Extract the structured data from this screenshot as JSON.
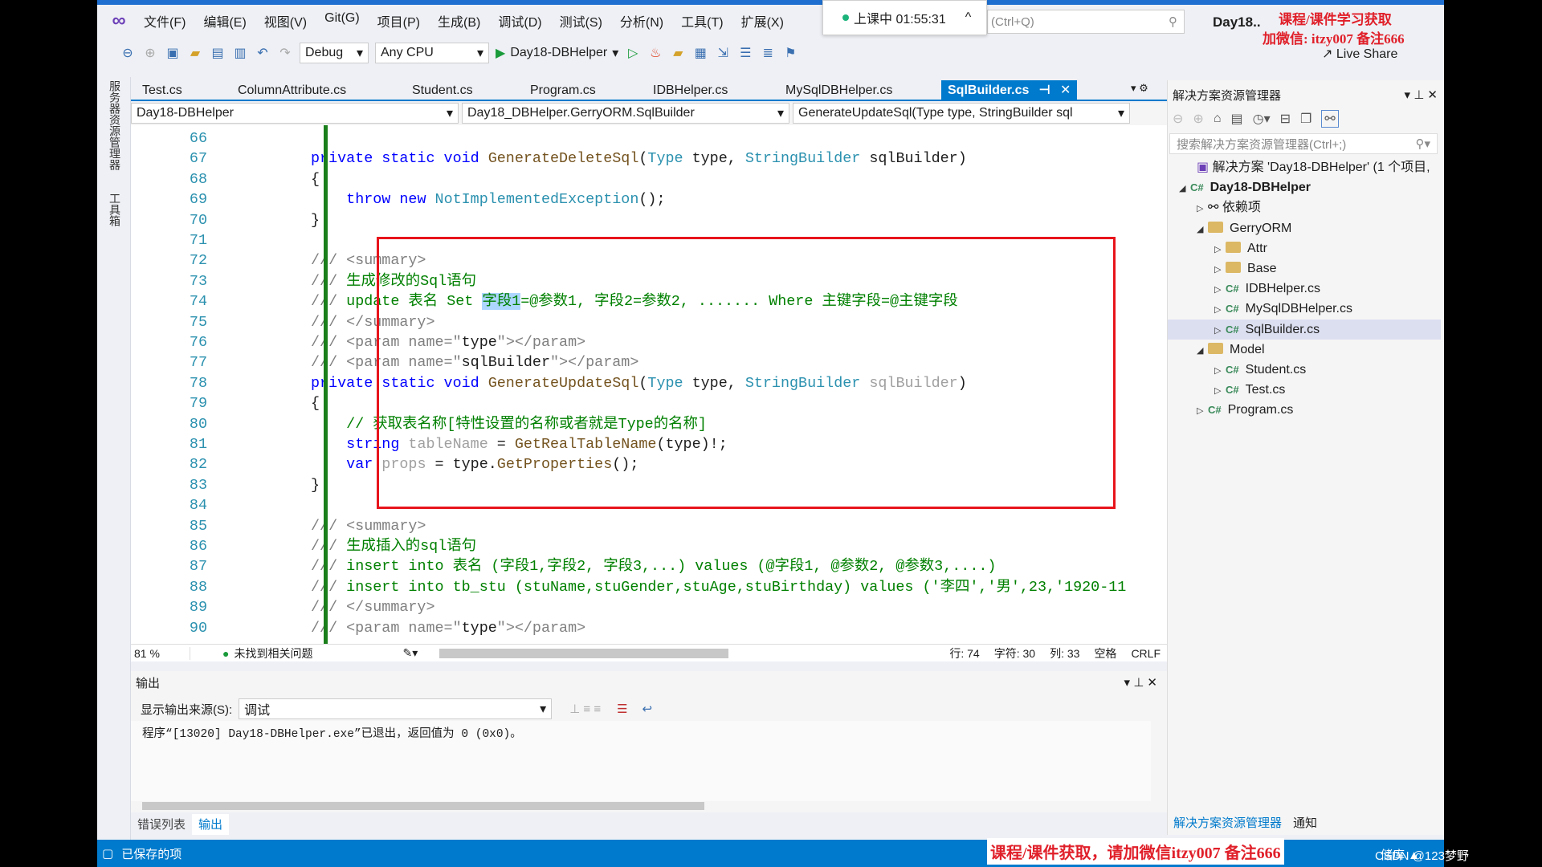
{
  "menu": {
    "items": [
      "文件(F)",
      "编辑(E)",
      "视图(V)",
      "Git(G)",
      "项目(P)",
      "生成(B)",
      "调试(D)",
      "测试(S)",
      "分析(N)",
      "工具(T)",
      "扩展(X)"
    ]
  },
  "recording": {
    "label": "上课中 01:55:31",
    "indicator_color": "#1bb37a"
  },
  "search": {
    "placeholder": "(Ctrl+Q)"
  },
  "solution_title": "Day18..",
  "watermark": {
    "line1": "课程/课件学习获取",
    "line2": "加微信: itzy007 备注666",
    "bottom": "课程/课件获取，请加微信itzy007 备注666"
  },
  "toolbar": {
    "config": "Debug",
    "platform": "Any CPU",
    "start_target": "Day18-DBHelper",
    "live_share": "Live Share"
  },
  "left_tool_tabs": [
    "服务器资源管理器",
    "工具箱"
  ],
  "tabs": [
    {
      "label": "Test.cs"
    },
    {
      "label": "ColumnAttribute.cs"
    },
    {
      "label": "Student.cs"
    },
    {
      "label": "Program.cs"
    },
    {
      "label": "IDBHelper.cs"
    },
    {
      "label": "MySqlDBHelper.cs"
    },
    {
      "label": "SqlBuilder.cs",
      "active": true
    }
  ],
  "navbar": {
    "project": "Day18-DBHelper",
    "class": "Day18_DBHelper.GerryORM.SqlBuilder",
    "member": "GenerateUpdateSql(Type type, StringBuilder sql"
  },
  "code_lines": [
    {
      "n": "66",
      "t": []
    },
    {
      "n": "67",
      "t": [
        [
          "private static void ",
          "kw"
        ],
        [
          "GenerateDeleteSql",
          "fn"
        ],
        [
          "(",
          "tx"
        ],
        [
          "Type",
          "ty"
        ],
        [
          " type, ",
          "tx"
        ],
        [
          "StringBuilder",
          "ty"
        ],
        [
          " sqlBuilder)",
          "tx"
        ]
      ]
    },
    {
      "n": "68",
      "t": [
        [
          "{",
          "tx"
        ]
      ]
    },
    {
      "n": "69",
      "t": [
        [
          "    ",
          "tx"
        ],
        [
          "throw new ",
          "kw"
        ],
        [
          "NotImplementedException",
          "ty"
        ],
        [
          "();",
          "tx"
        ]
      ]
    },
    {
      "n": "70",
      "t": [
        [
          "}",
          "tx"
        ]
      ]
    },
    {
      "n": "71",
      "t": []
    },
    {
      "n": "72",
      "t": [
        [
          "/// <summary>",
          "dc"
        ]
      ]
    },
    {
      "n": "73",
      "t": [
        [
          "/// ",
          "dc"
        ],
        [
          "生成修改的Sql语句",
          "cm"
        ]
      ]
    },
    {
      "n": "74",
      "t": [
        [
          "/// ",
          "dc"
        ],
        [
          "update 表名 Set ",
          "cm"
        ],
        [
          "字段1",
          "cm sel"
        ],
        [
          "=@参数1, 字段2=参数2, ....... Where 主键字段=@主键字段",
          "cm"
        ]
      ]
    },
    {
      "n": "75",
      "t": [
        [
          "/// </summary>",
          "dc"
        ]
      ]
    },
    {
      "n": "76",
      "t": [
        [
          "/// <param name=\"",
          "dc"
        ],
        [
          "type",
          "tx"
        ],
        [
          "\"></param>",
          "dc"
        ]
      ]
    },
    {
      "n": "77",
      "t": [
        [
          "/// <param name=\"",
          "dc"
        ],
        [
          "sqlBuilder",
          "tx"
        ],
        [
          "\"></param>",
          "dc"
        ]
      ]
    },
    {
      "n": "78",
      "t": [
        [
          "private static void ",
          "kw"
        ],
        [
          "GenerateUpdateSql",
          "fn"
        ],
        [
          "(",
          "tx"
        ],
        [
          "Type",
          "ty"
        ],
        [
          " type, ",
          "tx"
        ],
        [
          "StringBuilder",
          "ty"
        ],
        [
          " sqlBuilder",
          "fd"
        ],
        [
          ")",
          "tx"
        ]
      ]
    },
    {
      "n": "79",
      "t": [
        [
          "{",
          "tx"
        ]
      ]
    },
    {
      "n": "80",
      "t": [
        [
          "    ",
          "tx"
        ],
        [
          "// 获取表名称[特性设置的名称或者就是Type的名称]",
          "cm"
        ]
      ]
    },
    {
      "n": "81",
      "t": [
        [
          "    ",
          "tx"
        ],
        [
          "string",
          "kw"
        ],
        [
          " tableName",
          "fd"
        ],
        [
          " = ",
          "tx"
        ],
        [
          "GetRealTableName",
          "fn"
        ],
        [
          "(type)!;",
          "tx"
        ]
      ]
    },
    {
      "n": "82",
      "t": [
        [
          "    ",
          "tx"
        ],
        [
          "var",
          "kw"
        ],
        [
          " props",
          "fd"
        ],
        [
          " = type.",
          "tx"
        ],
        [
          "GetProperties",
          "fn"
        ],
        [
          "();",
          "tx"
        ]
      ]
    },
    {
      "n": "83",
      "t": [
        [
          "}",
          "tx"
        ]
      ]
    },
    {
      "n": "84",
      "t": []
    },
    {
      "n": "85",
      "t": [
        [
          "/// <summary>",
          "dc"
        ]
      ]
    },
    {
      "n": "86",
      "t": [
        [
          "/// ",
          "dc"
        ],
        [
          "生成插入的sql语句",
          "cm"
        ]
      ]
    },
    {
      "n": "87",
      "t": [
        [
          "/// ",
          "dc"
        ],
        [
          "insert into 表名 (字段1,字段2, 字段3,...) values (@字段1, @参数2, @参数3,....)",
          "cm"
        ]
      ]
    },
    {
      "n": "88",
      "t": [
        [
          "/// ",
          "dc"
        ],
        [
          "insert into tb_stu (stuName,stuGender,stuAge,stuBirthday) values ('李四','男',23,'1920-11",
          "cm"
        ]
      ]
    },
    {
      "n": "89",
      "t": [
        [
          "/// </summary>",
          "dc"
        ]
      ]
    },
    {
      "n": "90",
      "t": [
        [
          "/// <param name=\"",
          "dc"
        ],
        [
          "type",
          "tx"
        ],
        [
          "\"></param>",
          "dc"
        ]
      ]
    }
  ],
  "status": {
    "zoom": "81 %",
    "issues": "未找到相关问题",
    "line": "行: 74",
    "char": "字符: 30",
    "col": "列: 33",
    "whitespace": "空格",
    "eol": "CRLF"
  },
  "output": {
    "title": "输出",
    "source_label": "显示输出来源(S):",
    "source_value": "调试",
    "text": "程序“[13020] Day18-DBHelper.exe”已退出，返回值为 0 (0x0)。"
  },
  "bottom_tabs": [
    "错误列表",
    "输出"
  ],
  "statusbar": {
    "saved": "已保存的项",
    "repo": "储库 ▲",
    "csdn": "CSDN @123梦野"
  },
  "solution_explorer": {
    "title": "解决方案资源管理器",
    "search_placeholder": "搜索解决方案资源管理器(Ctrl+;)",
    "nodes": [
      {
        "label": "解决方案 'Day18-DBHelper' (1 个项目,",
        "type": "solution",
        "depth": 0,
        "exp": ""
      },
      {
        "label": "Day18-DBHelper",
        "type": "project",
        "depth": 0,
        "exp": "◢",
        "bold": true
      },
      {
        "label": "依赖项",
        "type": "deps",
        "depth": 1,
        "exp": "▷"
      },
      {
        "label": "GerryORM",
        "type": "folder",
        "depth": 1,
        "exp": "◢"
      },
      {
        "label": "Attr",
        "type": "folder",
        "depth": 2,
        "exp": "▷"
      },
      {
        "label": "Base",
        "type": "folder",
        "depth": 2,
        "exp": "▷"
      },
      {
        "label": "IDBHelper.cs",
        "type": "cs",
        "depth": 2,
        "exp": "▷"
      },
      {
        "label": "MySqlDBHelper.cs",
        "type": "cs",
        "depth": 2,
        "exp": "▷"
      },
      {
        "label": "SqlBuilder.cs",
        "type": "cs",
        "depth": 2,
        "exp": "▷",
        "selected": true
      },
      {
        "label": "Model",
        "type": "folder",
        "depth": 1,
        "exp": "◢"
      },
      {
        "label": "Student.cs",
        "type": "cs",
        "depth": 2,
        "exp": "▷"
      },
      {
        "label": "Test.cs",
        "type": "cs",
        "depth": 2,
        "exp": "▷"
      },
      {
        "label": "Program.cs",
        "type": "cs",
        "depth": 1,
        "exp": "▷"
      }
    ],
    "bottom_tabs": [
      "解决方案资源管理器",
      "通知"
    ]
  },
  "colors": {
    "accent": "#007acc",
    "highlight_box": "#e8141b",
    "keyword": "#0000ff",
    "type": "#2b91af",
    "comment": "#008000"
  }
}
